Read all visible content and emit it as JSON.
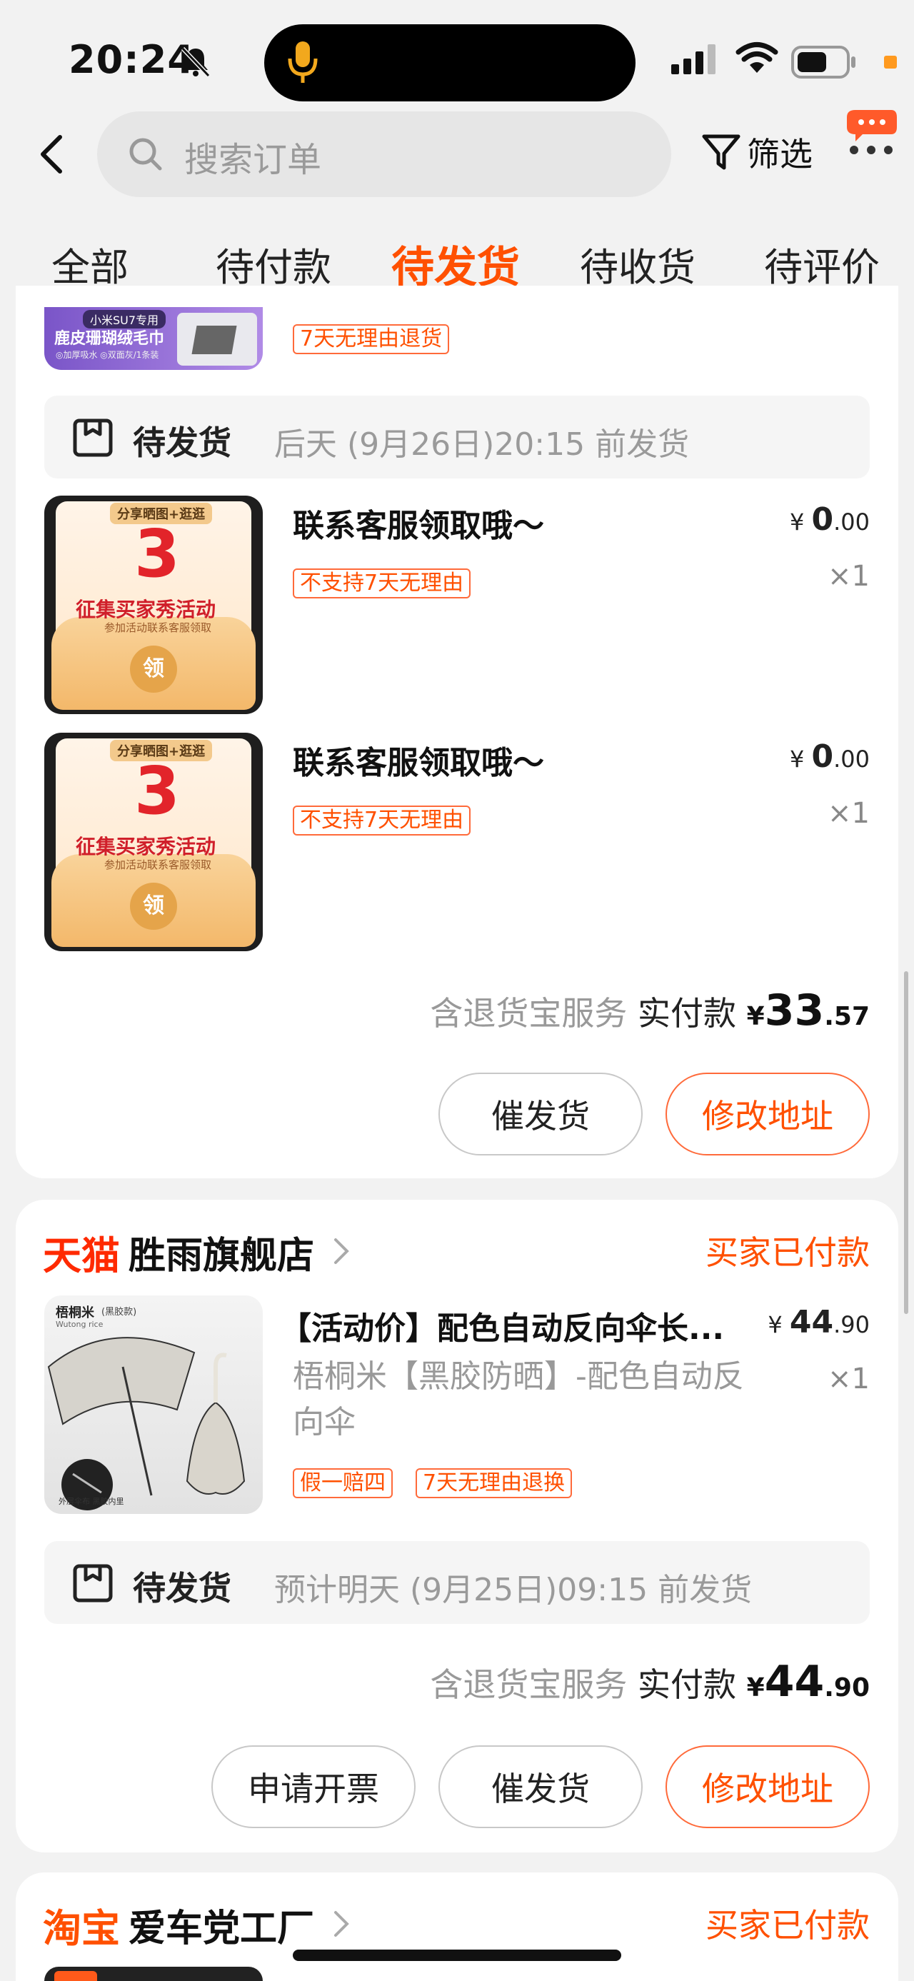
{
  "status_bar": {
    "time": "20:24"
  },
  "search": {
    "placeholder": "搜索订单",
    "filter_label": "筛选"
  },
  "tabs": [
    "全部",
    "待付款",
    "待发货",
    "待收货",
    "待评价"
  ],
  "active_tab": "待发货",
  "colors": {
    "accent": "#ff5000",
    "tmall_red": "#ff2a00"
  },
  "order1": {
    "top_item": {
      "badge": "小米SU7专用",
      "thumb_text": "鹿皮珊瑚绒毛巾",
      "thumb_sub": "◎加厚吸水  ◎双面灰/1条装",
      "tag": "7天无理由退货"
    },
    "shipping": {
      "title": "待发货",
      "desc": "后天 (9月26日)20:15 前发货"
    },
    "items": [
      {
        "name": "联系客服领取哦～",
        "price_int": "0",
        "price_dec": ".00",
        "qty": "×1",
        "tag": "不支持7天无理由",
        "thumb": {
          "top": "分享晒图+逛逛",
          "num": "3",
          "title": "征集买家秀活动",
          "sub": "参加活动联系客服领取",
          "seal": "领"
        }
      },
      {
        "name": "联系客服领取哦～",
        "price_int": "0",
        "price_dec": ".00",
        "qty": "×1",
        "tag": "不支持7天无理由",
        "thumb": {
          "top": "分享晒图+逛逛",
          "num": "3",
          "title": "征集买家秀活动",
          "sub": "参加活动联系客服领取",
          "seal": "领"
        }
      }
    ],
    "summary": {
      "service": "含退货宝服务",
      "label": "实付款",
      "currency": "¥",
      "amount_int": "33",
      "amount_dec": ".57"
    },
    "buttons": {
      "urge": "催发货",
      "change_address": "修改地址"
    }
  },
  "order2": {
    "shop_brand": "天猫",
    "shop_name": "胜雨旗舰店",
    "status": "买家已付款",
    "item": {
      "name": "【活动价】配色自动反向伞长...",
      "spec": "梧桐米【黑胶防晒】-配色自动反向伞",
      "price_int": "44",
      "price_dec": ".90",
      "qty": "×1",
      "tags": [
        "假一赔四",
        "7天无理由退换"
      ],
      "thumb": {
        "brand": "梧桐米",
        "brand_en": "Wutong rice",
        "variant": "(黑胶款)",
        "caption": "外层伞布 黑胶内里"
      }
    },
    "shipping": {
      "title": "待发货",
      "desc": "预计明天 (9月25日)09:15 前发货"
    },
    "summary": {
      "service": "含退货宝服务",
      "label": "实付款",
      "currency": "¥",
      "amount_int": "44",
      "amount_dec": ".90"
    },
    "buttons": {
      "invoice": "申请开票",
      "urge": "催发货",
      "change_address": "修改地址"
    }
  },
  "order3": {
    "shop_brand": "淘宝",
    "shop_name": "爱车党工厂",
    "status": "买家已付款"
  }
}
